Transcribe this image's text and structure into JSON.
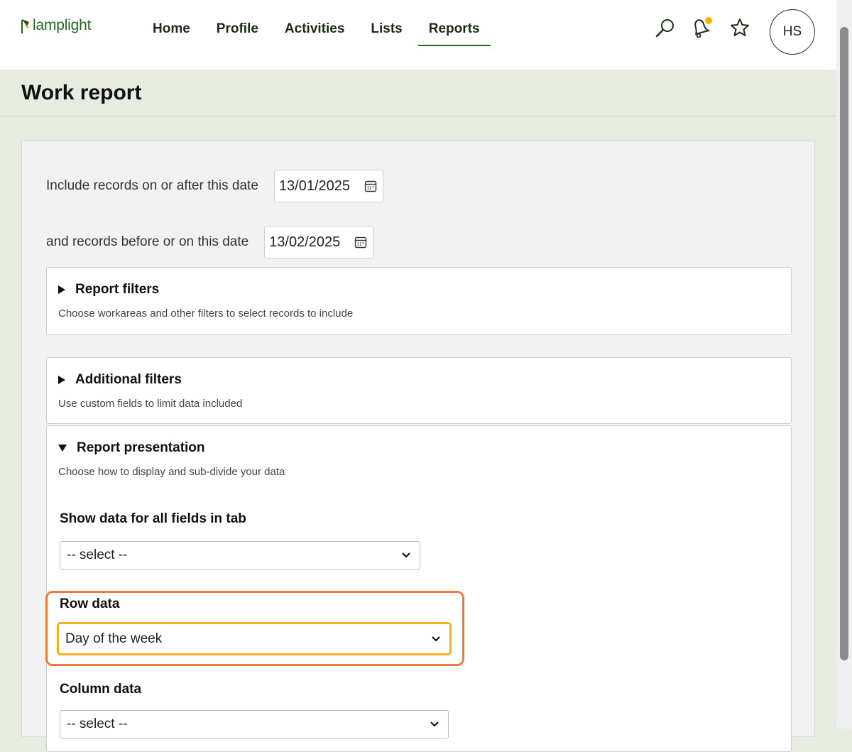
{
  "app": {
    "logo_text": "lamplight"
  },
  "nav": {
    "items": [
      {
        "label": "Home"
      },
      {
        "label": "Profile"
      },
      {
        "label": "Activities"
      },
      {
        "label": "Lists"
      },
      {
        "label": "Reports"
      }
    ],
    "active_item": "Reports",
    "icons": [
      "search-icon",
      "bell-icon",
      "star-icon"
    ],
    "avatar_initials": "HS",
    "notification_dot_color": "#f5b300"
  },
  "page": {
    "title": "Work report"
  },
  "filters": {
    "start_label": "Include records on or after this date",
    "start_value": "13/01/2025",
    "end_label": "and records before or on this date",
    "end_value": "13/02/2025"
  },
  "sections": {
    "report_filters": {
      "title": "Report filters",
      "desc": "Choose workareas and other filters to select records to include",
      "expanded": false
    },
    "additional_filters": {
      "title": "Additional filters",
      "desc": "Use custom fields to limit data included",
      "expanded": false
    },
    "report_presentation": {
      "title": "Report presentation",
      "desc": "Choose how to display and sub-divide your data",
      "expanded": true,
      "show_all_label": "Show data for all fields in tab",
      "show_all_value": "-- select --",
      "row_label": "Row data",
      "row_value": "Day of the week",
      "column_label": "Column data",
      "column_value": "-- select --"
    }
  },
  "colors": {
    "brand_green": "#1f6b1f",
    "highlight_outline": "#ee7b3d",
    "focus_outline": "#f3b21b",
    "page_bg": "#e6ecdf"
  }
}
